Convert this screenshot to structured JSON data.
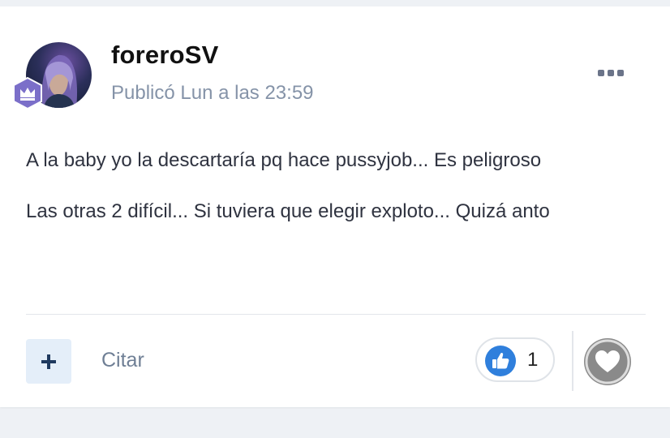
{
  "post": {
    "author": "foreroSV",
    "meta": "Publicó Lun a las 23:59",
    "paragraphs": [
      "A la baby yo la descartaría pq hace pussyjob... Es peligroso",
      "Las otras 2 difícil... Si tuviera que elegir exploto... Quizá anto"
    ]
  },
  "actions": {
    "quote_label": "Citar",
    "like_count": "1"
  },
  "colors": {
    "like": "#2f7fdc",
    "badge": "#7b6fc9",
    "plus": "#1f3a5f",
    "react": "#8a8a8a"
  },
  "icons": {
    "menu": "ellipsis-icon",
    "badge": "crown-icon",
    "plus": "plus-icon",
    "like": "thumbs-up-icon",
    "react": "heart-icon"
  }
}
